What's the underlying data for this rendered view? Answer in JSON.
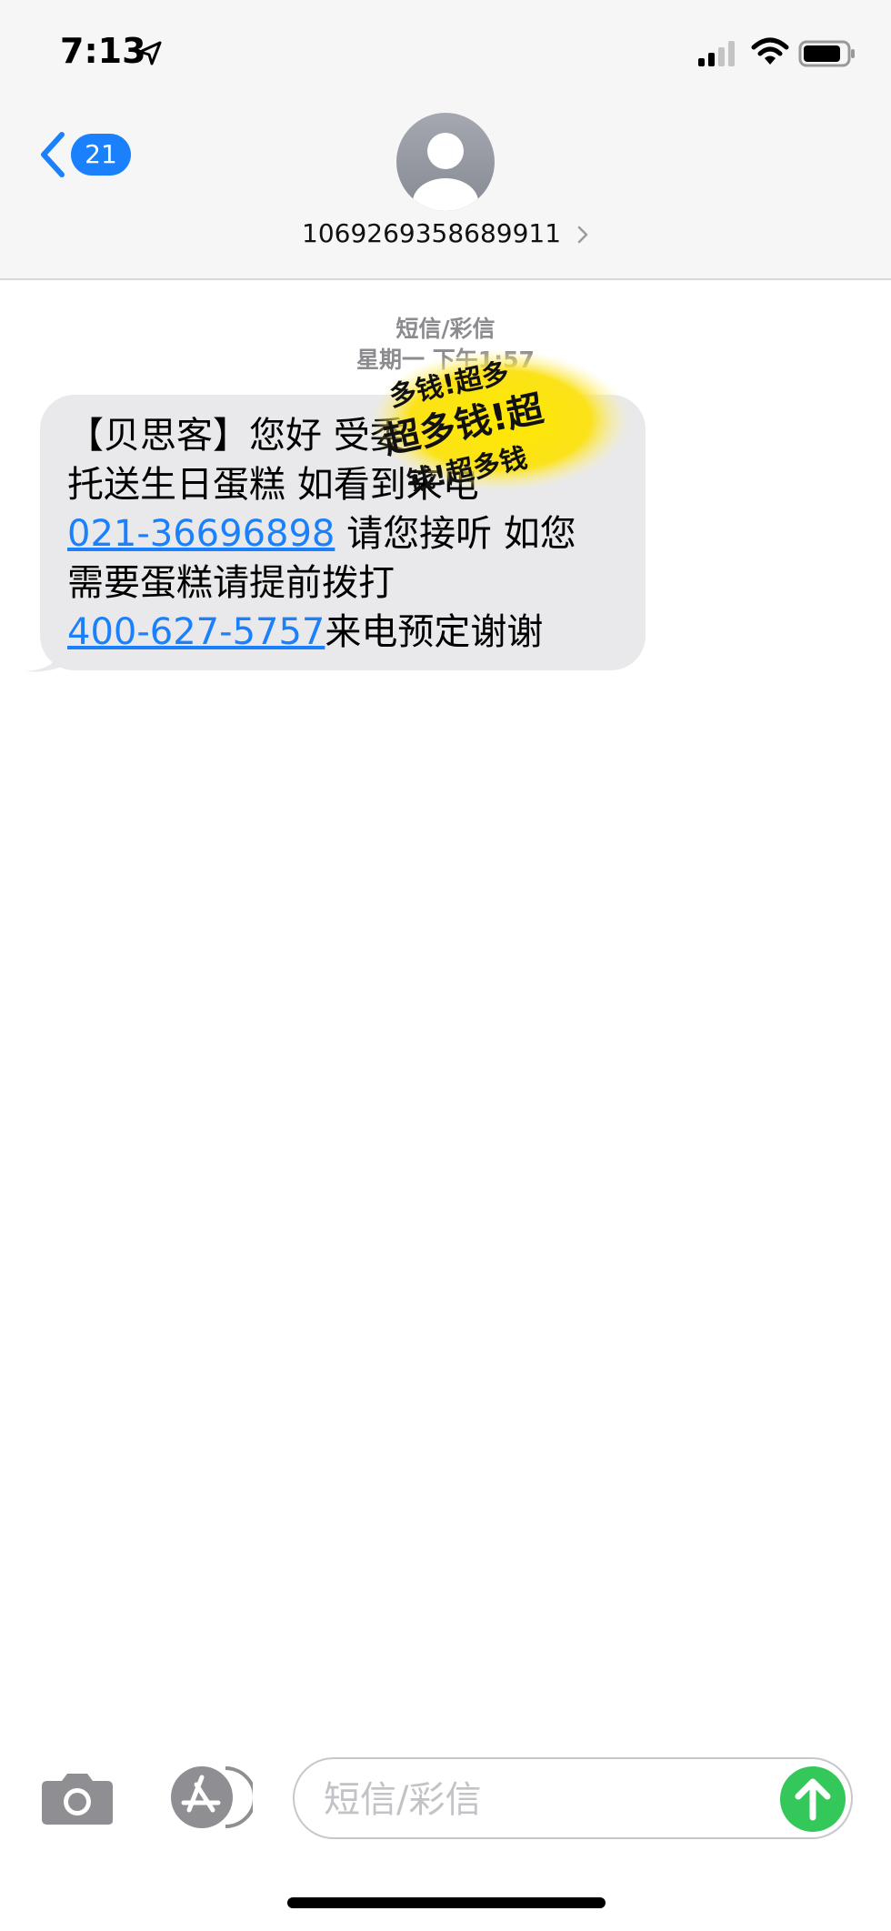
{
  "status_bar": {
    "time": "7:13",
    "icons": [
      "location-arrow-icon",
      "cellular-signal-icon",
      "wifi-icon",
      "battery-icon"
    ]
  },
  "nav": {
    "back_count": "21",
    "contact": "1069269358689911",
    "avatar_icon": "person-icon",
    "accent_color": "#1a80fb"
  },
  "conversation": {
    "message_type": "短信/彩信",
    "timestamp": "星期一 下午1:57",
    "message": {
      "lines": [
        "【贝思客】您好 受",
        "托送生日蛋糕 如看到来电",
        "请您接听 如您",
        "需要蛋糕请提前拨打",
        "来电预定谢谢"
      ],
      "line_tail_1": "委",
      "phone_1": "021-36696898",
      "phone_2": "400-627-5757"
    },
    "sticker_text": [
      "多钱!超多",
      "超多钱!超",
      "钱!超多钱"
    ]
  },
  "composer": {
    "placeholder": "短信/彩信",
    "value": "",
    "icons": [
      "camera-icon",
      "app-store-icon",
      "send-arrow-icon"
    ],
    "send_color": "#34c759"
  }
}
